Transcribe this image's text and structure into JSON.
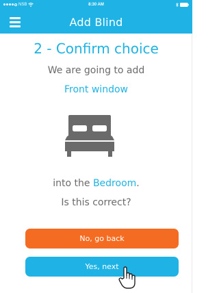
{
  "status_bar": {
    "carrier": "NSB",
    "time": "8:30 AM"
  },
  "header": {
    "title": "Add Blind",
    "menu_icon": "hamburger-menu-icon"
  },
  "main": {
    "step_title": "2 - Confirm choice",
    "intro": "We are going to add",
    "blind_name": "Front window",
    "bed_icon": "bed-icon",
    "room_prefix": "into the ",
    "room_name": "Bedroom",
    "room_suffix": ".",
    "question": "Is this correct?"
  },
  "buttons": {
    "back_label": "No, go back",
    "next_label": "Yes, next"
  },
  "colors": {
    "accent": "#1eb3e4",
    "back_button": "#f36c21",
    "text_gray": "#6b6b6b",
    "icon_gray": "#6a6a6a"
  }
}
